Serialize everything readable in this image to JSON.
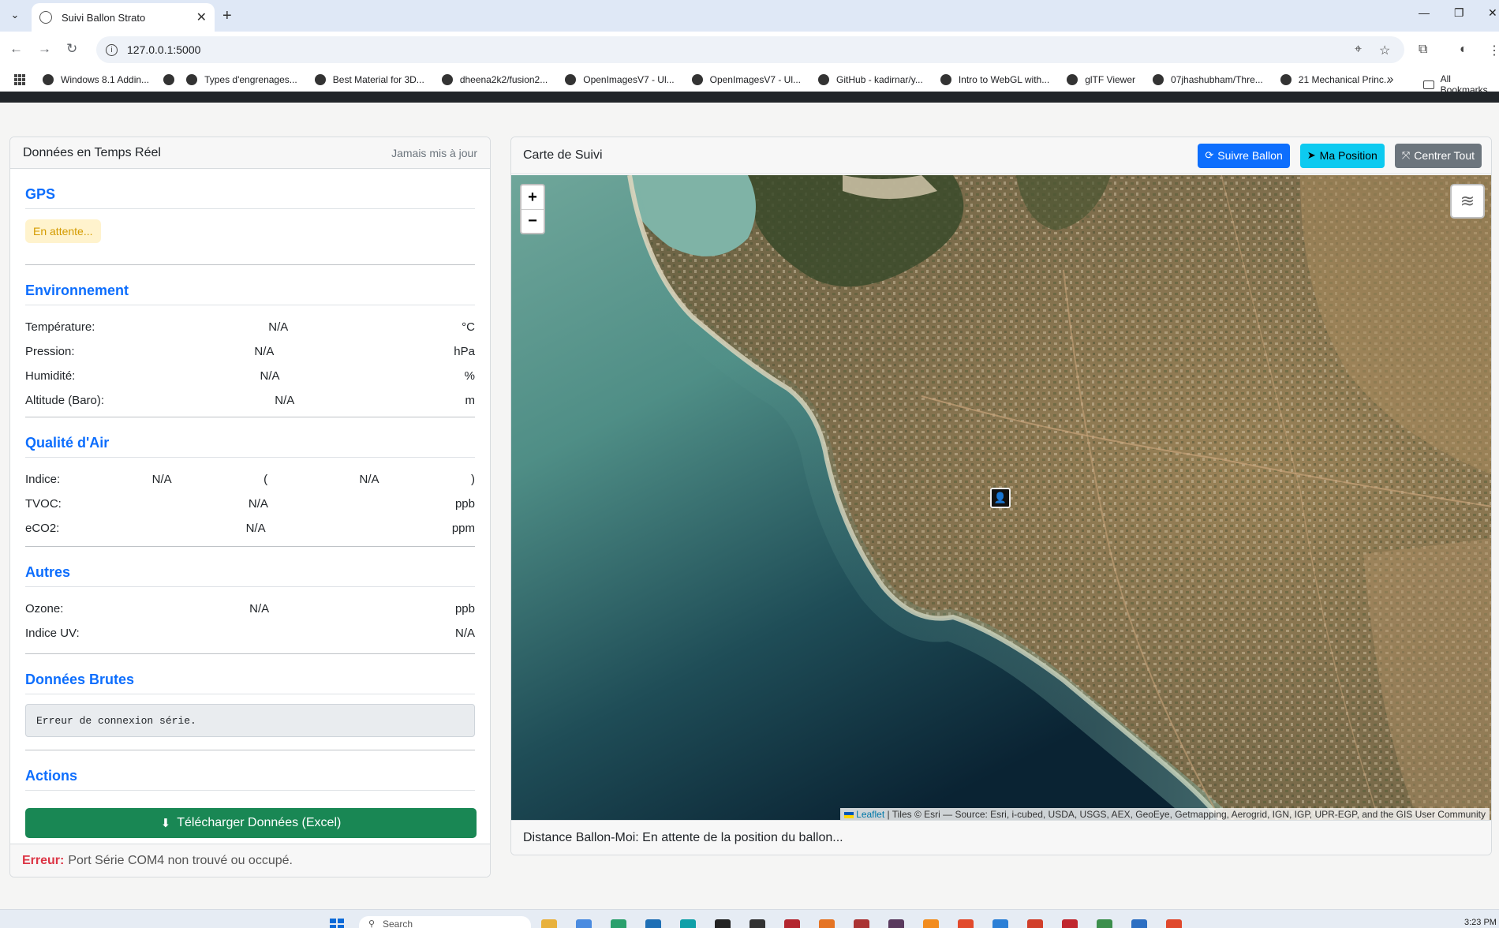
{
  "browser": {
    "tab_title": "Suivi Ballon Strato",
    "url": "127.0.0.1:5000",
    "bookmarks": [
      "Windows 8.1 Addin...",
      "",
      "Types d'engrenages...",
      "Best Material for 3D...",
      "dheena2k2/fusion2...",
      "OpenImagesV7 - Ul...",
      "OpenImagesV7 - Ul...",
      "GitHub - kadirnar/y...",
      "Intro to WebGL with...",
      "glTF Viewer",
      "07jhashubham/Thre...",
      "21 Mechanical Princ..."
    ],
    "all_bookmarks": "All Bookmarks"
  },
  "left_panel": {
    "title": "Données en Temps Réel",
    "last_update": "Jamais mis à jour",
    "gps": {
      "title": "GPS",
      "status": "En attente..."
    },
    "environment": {
      "title": "Environnement",
      "rows": [
        {
          "label": "Température:",
          "value": "N/A",
          "unit": "°C"
        },
        {
          "label": "Pression:",
          "value": "N/A",
          "unit": "hPa"
        },
        {
          "label": "Humidité:",
          "value": "N/A",
          "unit": "%"
        },
        {
          "label": "Altitude (Baro):",
          "value": "N/A",
          "unit": "m"
        }
      ]
    },
    "air_quality": {
      "title": "Qualité d'Air",
      "index_label": "Indice:",
      "index_value": "N/A",
      "index_open": "(",
      "index_desc": "N/A",
      "index_close": ")",
      "rows": [
        {
          "label": "TVOC:",
          "value": "N/A",
          "unit": "ppb"
        },
        {
          "label": "eCO2:",
          "value": "N/A",
          "unit": "ppm"
        }
      ]
    },
    "others": {
      "title": "Autres",
      "ozone_label": "Ozone:",
      "ozone_value": "N/A",
      "ozone_unit": "ppb",
      "uv_label": "Indice UV:",
      "uv_value": "N/A"
    },
    "raw": {
      "title": "Données Brutes",
      "text": "Erreur de connexion série."
    },
    "actions": {
      "title": "Actions",
      "download_label": "Télécharger Données (Excel)"
    },
    "footer": {
      "error_label": "Erreur:",
      "error_text": "Port Série COM4 non trouvé ou occupé."
    }
  },
  "map_panel": {
    "title": "Carte de Suivi",
    "buttons": {
      "follow": "Suivre Ballon",
      "my_position": "Ma Position",
      "center_all": "Centrer Tout"
    },
    "zoom_in": "+",
    "zoom_out": "−",
    "attribution_leaflet": "Leaflet",
    "attribution_text": " | Tiles © Esri — Source: Esri, i-cubed, USDA, USGS, AEX, GeoEye, Getmapping, Aerogrid, IGN, IGP, UPR-EGP, and the GIS User Community",
    "distance": "Distance Ballon-Moi: En attente de la position du ballon..."
  },
  "taskbar": {
    "search_placeholder": "Search",
    "time": "3:23 PM"
  },
  "icons": {
    "tab_favicon": "globe-icon",
    "marker": "balloon-marker-icon",
    "layers": "layers-icon",
    "download": "download-icon"
  },
  "colors": {
    "primary": "#0d6efd",
    "success": "#198754",
    "info": "#0dcaf0",
    "secondary": "#6c757d",
    "danger": "#dc3545",
    "warning_text": "#d49b00"
  }
}
